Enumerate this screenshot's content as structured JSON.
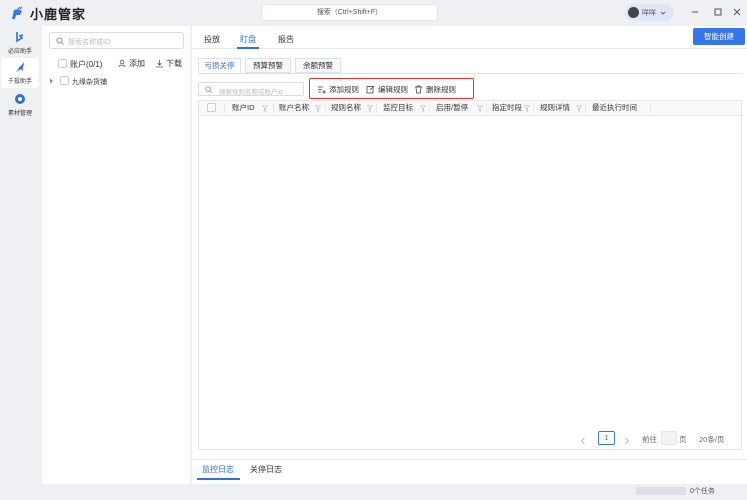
{
  "app": {
    "title": "小鹿管家",
    "search_label": "搜索（Ctrl+Shift+F）",
    "user_name": "咩咩"
  },
  "rail": {
    "items": [
      {
        "label": "必应助手",
        "icon": "bing-icon"
      },
      {
        "label": "千投助手",
        "icon": "feather-icon"
      },
      {
        "label": "素材管理",
        "icon": "asset-icon"
      }
    ]
  },
  "accounts": {
    "search_placeholder": "搜索名称或ID",
    "header_label": "账户(0/1)",
    "add_label": "添加",
    "download_label": "下载",
    "tree": [
      {
        "label": "九缘杂货铺"
      }
    ]
  },
  "main": {
    "tabs": [
      {
        "label": "投放"
      },
      {
        "label": "盯盘"
      },
      {
        "label": "报告"
      }
    ],
    "active_tab": "盯盘",
    "create_button": "智能创建",
    "sub_tabs": [
      {
        "label": "亏损关停"
      },
      {
        "label": "预算预警"
      },
      {
        "label": "余额预警"
      }
    ],
    "rule_search_placeholder": "搜索规则名称或账户id",
    "toolbar": {
      "add_rule": "添加规则",
      "edit_rule": "编辑规则",
      "delete_rule": "删除规则"
    },
    "table": {
      "columns": [
        "账户ID",
        "账户名称",
        "规则名称",
        "监控目标",
        "启用/暂停",
        "指定时段",
        "规则详情",
        "最近执行时间"
      ],
      "rows": []
    },
    "pagination": {
      "current_page": "1",
      "goto_label": "前往",
      "page_unit": "页",
      "page_size": "20条/页"
    },
    "log_tabs": [
      {
        "label": "监控日志"
      },
      {
        "label": "关停日志"
      }
    ]
  },
  "status": {
    "tasks_label": "0个任务",
    "progress": 0
  },
  "colors": {
    "accent": "#3776e8",
    "highlight_border": "#e5312f",
    "background": "#eef0f4"
  }
}
